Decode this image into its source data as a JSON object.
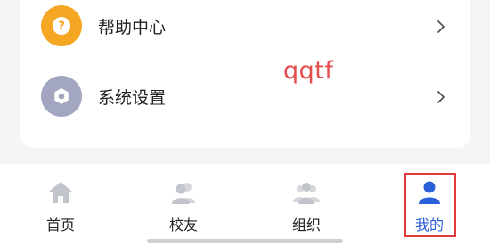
{
  "settings_list": {
    "items": [
      {
        "label": "帮助中心",
        "icon": "help-icon",
        "icon_bg": "#f5a623"
      },
      {
        "label": "系统设置",
        "icon": "gear-icon",
        "icon_bg": "#a3a6c0"
      }
    ]
  },
  "overlay": {
    "watermark_text": "qqtf",
    "watermark_color": "#e54d4d"
  },
  "tab_bar": {
    "active_tab": "我的",
    "active_color": "#2a5fd8",
    "tabs": [
      {
        "label": "首页",
        "icon": "home-icon"
      },
      {
        "label": "校友",
        "icon": "alumni-icon"
      },
      {
        "label": "组织",
        "icon": "organization-icon"
      },
      {
        "label": "我的",
        "icon": "profile-icon"
      }
    ]
  }
}
